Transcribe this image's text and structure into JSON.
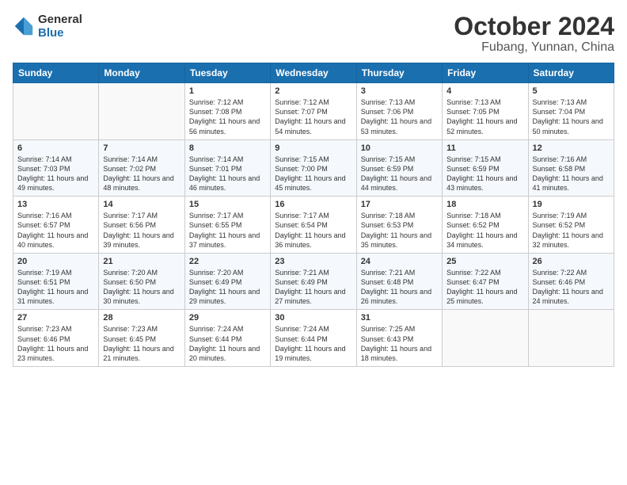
{
  "header": {
    "logo_line1": "General",
    "logo_line2": "Blue",
    "title": "October 2024",
    "subtitle": "Fubang, Yunnan, China"
  },
  "days_of_week": [
    "Sunday",
    "Monday",
    "Tuesday",
    "Wednesday",
    "Thursday",
    "Friday",
    "Saturday"
  ],
  "weeks": [
    [
      {
        "day": "",
        "sunrise": "",
        "sunset": "",
        "daylight": ""
      },
      {
        "day": "",
        "sunrise": "",
        "sunset": "",
        "daylight": ""
      },
      {
        "day": "1",
        "sunrise": "Sunrise: 7:12 AM",
        "sunset": "Sunset: 7:08 PM",
        "daylight": "Daylight: 11 hours and 56 minutes."
      },
      {
        "day": "2",
        "sunrise": "Sunrise: 7:12 AM",
        "sunset": "Sunset: 7:07 PM",
        "daylight": "Daylight: 11 hours and 54 minutes."
      },
      {
        "day": "3",
        "sunrise": "Sunrise: 7:13 AM",
        "sunset": "Sunset: 7:06 PM",
        "daylight": "Daylight: 11 hours and 53 minutes."
      },
      {
        "day": "4",
        "sunrise": "Sunrise: 7:13 AM",
        "sunset": "Sunset: 7:05 PM",
        "daylight": "Daylight: 11 hours and 52 minutes."
      },
      {
        "day": "5",
        "sunrise": "Sunrise: 7:13 AM",
        "sunset": "Sunset: 7:04 PM",
        "daylight": "Daylight: 11 hours and 50 minutes."
      }
    ],
    [
      {
        "day": "6",
        "sunrise": "Sunrise: 7:14 AM",
        "sunset": "Sunset: 7:03 PM",
        "daylight": "Daylight: 11 hours and 49 minutes."
      },
      {
        "day": "7",
        "sunrise": "Sunrise: 7:14 AM",
        "sunset": "Sunset: 7:02 PM",
        "daylight": "Daylight: 11 hours and 48 minutes."
      },
      {
        "day": "8",
        "sunrise": "Sunrise: 7:14 AM",
        "sunset": "Sunset: 7:01 PM",
        "daylight": "Daylight: 11 hours and 46 minutes."
      },
      {
        "day": "9",
        "sunrise": "Sunrise: 7:15 AM",
        "sunset": "Sunset: 7:00 PM",
        "daylight": "Daylight: 11 hours and 45 minutes."
      },
      {
        "day": "10",
        "sunrise": "Sunrise: 7:15 AM",
        "sunset": "Sunset: 6:59 PM",
        "daylight": "Daylight: 11 hours and 44 minutes."
      },
      {
        "day": "11",
        "sunrise": "Sunrise: 7:15 AM",
        "sunset": "Sunset: 6:59 PM",
        "daylight": "Daylight: 11 hours and 43 minutes."
      },
      {
        "day": "12",
        "sunrise": "Sunrise: 7:16 AM",
        "sunset": "Sunset: 6:58 PM",
        "daylight": "Daylight: 11 hours and 41 minutes."
      }
    ],
    [
      {
        "day": "13",
        "sunrise": "Sunrise: 7:16 AM",
        "sunset": "Sunset: 6:57 PM",
        "daylight": "Daylight: 11 hours and 40 minutes."
      },
      {
        "day": "14",
        "sunrise": "Sunrise: 7:17 AM",
        "sunset": "Sunset: 6:56 PM",
        "daylight": "Daylight: 11 hours and 39 minutes."
      },
      {
        "day": "15",
        "sunrise": "Sunrise: 7:17 AM",
        "sunset": "Sunset: 6:55 PM",
        "daylight": "Daylight: 11 hours and 37 minutes."
      },
      {
        "day": "16",
        "sunrise": "Sunrise: 7:17 AM",
        "sunset": "Sunset: 6:54 PM",
        "daylight": "Daylight: 11 hours and 36 minutes."
      },
      {
        "day": "17",
        "sunrise": "Sunrise: 7:18 AM",
        "sunset": "Sunset: 6:53 PM",
        "daylight": "Daylight: 11 hours and 35 minutes."
      },
      {
        "day": "18",
        "sunrise": "Sunrise: 7:18 AM",
        "sunset": "Sunset: 6:52 PM",
        "daylight": "Daylight: 11 hours and 34 minutes."
      },
      {
        "day": "19",
        "sunrise": "Sunrise: 7:19 AM",
        "sunset": "Sunset: 6:52 PM",
        "daylight": "Daylight: 11 hours and 32 minutes."
      }
    ],
    [
      {
        "day": "20",
        "sunrise": "Sunrise: 7:19 AM",
        "sunset": "Sunset: 6:51 PM",
        "daylight": "Daylight: 11 hours and 31 minutes."
      },
      {
        "day": "21",
        "sunrise": "Sunrise: 7:20 AM",
        "sunset": "Sunset: 6:50 PM",
        "daylight": "Daylight: 11 hours and 30 minutes."
      },
      {
        "day": "22",
        "sunrise": "Sunrise: 7:20 AM",
        "sunset": "Sunset: 6:49 PM",
        "daylight": "Daylight: 11 hours and 29 minutes."
      },
      {
        "day": "23",
        "sunrise": "Sunrise: 7:21 AM",
        "sunset": "Sunset: 6:49 PM",
        "daylight": "Daylight: 11 hours and 27 minutes."
      },
      {
        "day": "24",
        "sunrise": "Sunrise: 7:21 AM",
        "sunset": "Sunset: 6:48 PM",
        "daylight": "Daylight: 11 hours and 26 minutes."
      },
      {
        "day": "25",
        "sunrise": "Sunrise: 7:22 AM",
        "sunset": "Sunset: 6:47 PM",
        "daylight": "Daylight: 11 hours and 25 minutes."
      },
      {
        "day": "26",
        "sunrise": "Sunrise: 7:22 AM",
        "sunset": "Sunset: 6:46 PM",
        "daylight": "Daylight: 11 hours and 24 minutes."
      }
    ],
    [
      {
        "day": "27",
        "sunrise": "Sunrise: 7:23 AM",
        "sunset": "Sunset: 6:46 PM",
        "daylight": "Daylight: 11 hours and 23 minutes."
      },
      {
        "day": "28",
        "sunrise": "Sunrise: 7:23 AM",
        "sunset": "Sunset: 6:45 PM",
        "daylight": "Daylight: 11 hours and 21 minutes."
      },
      {
        "day": "29",
        "sunrise": "Sunrise: 7:24 AM",
        "sunset": "Sunset: 6:44 PM",
        "daylight": "Daylight: 11 hours and 20 minutes."
      },
      {
        "day": "30",
        "sunrise": "Sunrise: 7:24 AM",
        "sunset": "Sunset: 6:44 PM",
        "daylight": "Daylight: 11 hours and 19 minutes."
      },
      {
        "day": "31",
        "sunrise": "Sunrise: 7:25 AM",
        "sunset": "Sunset: 6:43 PM",
        "daylight": "Daylight: 11 hours and 18 minutes."
      },
      {
        "day": "",
        "sunrise": "",
        "sunset": "",
        "daylight": ""
      },
      {
        "day": "",
        "sunrise": "",
        "sunset": "",
        "daylight": ""
      }
    ]
  ]
}
